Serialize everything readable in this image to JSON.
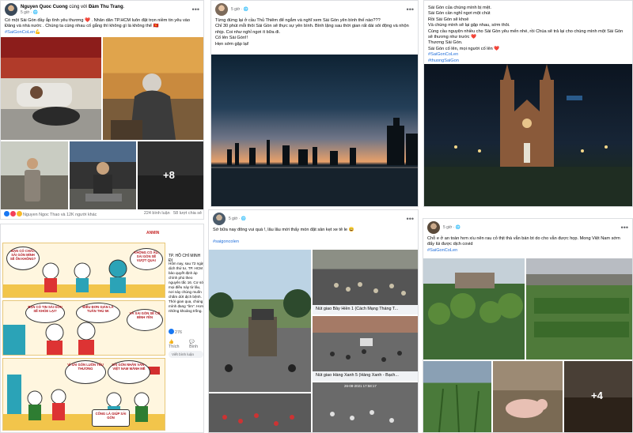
{
  "post1": {
    "author": "Nguyen Quoc Cuong",
    "with_text": "cùng với",
    "tagged": "Đàm Thu Trang",
    "time": "5 giờ",
    "text": "Có một Sài Gòn đầy ắp tình yêu thương ❤️ . Nhân dân TP.HCM luôn đặt trọn niềm tin yêu vào Đảng và nhà nước . Chúng ta cùng nhau cố gắng thì không gì là không thể 🇻🇳",
    "hashtag": "#SaiGonCoLen💪",
    "more_photos": "+8",
    "reactions": "Nguyen Ngoc Thao và 12K người khác",
    "comments": "224 bình luận",
    "shares": "58 lượt chia sẻ"
  },
  "post2": {
    "author": "",
    "time": "5 giờ",
    "text": "Từng đứng lại ở cầu Thủ Thiêm để ngắm và nghĩ xem Sài Gòn yên bình thế nào???\nChỉ 30 phút mỗi thôi Sài Gòn sẽ thực sự yên bình. Bình lặng sau thời gian rất dài sôi động và nhộn nhịp. Coi như nghỉ ngơi ít bữa đi.\nCố lên Sài Gòn!!\nHẹn sớm gặp lại!"
  },
  "post3": {
    "lines": [
      "Sài Gòn của chúng mình bị mệt.",
      "Sài Gòn cần nghỉ ngơi một chút",
      "Rồi Sài Gòn sẽ khoẻ",
      "Và chúng mình sẽ lại gặp nhau, sớm thôi.",
      "Cùng cầu nguyện nhiều cho Sài Gòn yêu mến nhé, rồi Chúa sẽ trả lại cho chúng mình một Sài Gòn sẽ thương như trước ❤️",
      "Thương Sài Gòn.",
      "Sài Gòn cố lên, mọi người cố lên ❤️"
    ],
    "hashtags": [
      "#SaiGonCoLen",
      "#thuongSaiGon"
    ]
  },
  "post4": {
    "logo": "ANMIN",
    "page_name": "",
    "location": "TP. HỒ CHÍ MINH ĐI",
    "text": "Hôm nay, sau 72 ngày dịch thứ tư, TP. HCM bảo quyết định áp chính phủ theo nguyên tắc 16. Cơ sở mọi điều này từ lâu, nơi này chúng muốn chấm dứt dịch bệnh.\nThời gian qua, chúng mình đang \"ôm\". Hơn những khoảng trống.",
    "likes": "276",
    "like_label": "Thích",
    "comment_label": "Bình",
    "comment_placeholder": "Viết bình luận",
    "comic_bubbles": [
      "BẠN CÓ CHẮC SÀI GÒN MÌNH SẼ ỔN KHÔNG?",
      "KHÔNG CÓ ÂU, SÀI GÒN SẼ VƯỢT QUA!",
      "BẠN CÓ TIN SÀI GÒN SẼ KHỎE LẠI?",
      "ĐIỀU ĐƠN GIẢN LÀ TUÂN THỦ 5K",
      "VÀ SÀI GÒN SẼ CÓ BÌNH YÊN",
      "VÌ SÀI GÒN LUÔN YÊU THƯƠNG",
      "SÀI GÒN NHÂN VĂN - VIỆT NAM MÃNH MẼ",
      "CÔNG LÀ GIÚP SÀI GÒN"
    ]
  },
  "post5": {
    "author": "",
    "time": "5 giờ",
    "text": "Sớ bữa nay đông vui quá !, lâu lâu mới thấy món đặt sản kẹt xe tê le 😄",
    "hashtag": "#saigoncolen",
    "captions": [
      "Nút giao Bảy Hiền 1 (Cách Mạng Tháng T...",
      "Nút giao Hàng Xanh 5 (Hàng Xanh - Bạch..."
    ],
    "overlay": "26-08-2021 17:58:17"
  },
  "post6": {
    "author": "",
    "time": "5 giờ",
    "text": "Chỗ e ở an toàn hơn xíu nên rau cỏ thịt thà vẫn bán bt do cho vẫn được họp. Mong Việt Nam sớm đẩy lùi được dịch covid",
    "hashtag": "#SaiGonCoLen",
    "more_photos": "+4"
  },
  "colors": {
    "link": "#216fdb",
    "meta": "#65676b",
    "text": "#050505",
    "border": "#dddfe2"
  }
}
